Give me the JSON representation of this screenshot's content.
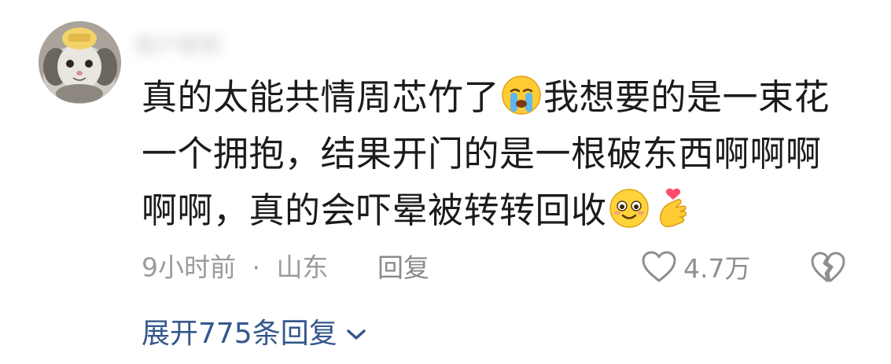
{
  "comment": {
    "username": "用户昵称",
    "text_line1_a": "真的太能共情周芯竹了",
    "emoji_1": "crying-face-emoji",
    "text_line1_b": "我想要的是一束花一个拥抱，结果开门的是一根破东西啊啊啊啊啊，真的会吓晕被转转回收",
    "emoji_2": "smiling-face-emoji",
    "emoji_3": "finger-heart-emoji",
    "time": "9小时前",
    "separator": "·",
    "location": "山东",
    "reply_label": "回复",
    "like_count": "4.7万",
    "expand_label": "展开775条回复"
  },
  "colors": {
    "link": "#35588c",
    "meta": "#9b9b9b",
    "text": "#1b1b1b"
  }
}
